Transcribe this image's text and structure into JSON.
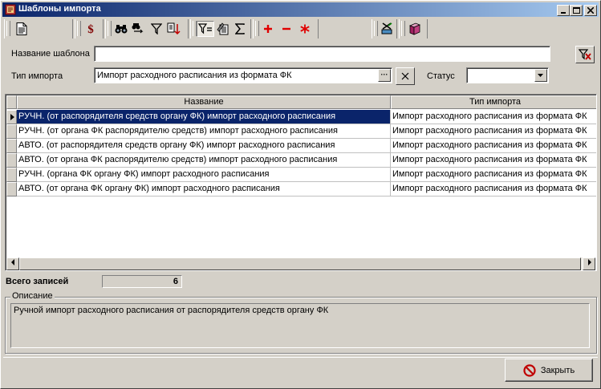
{
  "window": {
    "title": "Шаблоны импорта",
    "controls": [
      "minimize",
      "maximize",
      "close"
    ]
  },
  "toolbar": {
    "icons": [
      "new-document-icon",
      "money-icon",
      "binoculars-icon",
      "find-next-icon",
      "filter-icon",
      "sort-icon",
      "filter-by-selection-icon",
      "edit-list-icon",
      "sum-icon",
      "add-icon",
      "remove-icon",
      "asterisk-icon",
      "export-icon",
      "book-icon"
    ]
  },
  "filters": {
    "template_name_label": "Название шаблона",
    "template_name_value": "",
    "import_type_label": "Тип импорта",
    "import_type_value": "Импорт расходного расписания из формата ФК",
    "ellipsis_label": "···",
    "status_label": "Статус",
    "status_value": ""
  },
  "table": {
    "columns": [
      "Название",
      "Тип импорта"
    ],
    "rows": [
      {
        "name": "РУЧН. (от распорядителя средств органу ФК) импорт расходного расписания",
        "type": "Импорт расходного расписания из формата ФК",
        "selected": true
      },
      {
        "name": "РУЧН. (от органа ФК распорядителю средств) импорт расходного расписания",
        "type": "Импорт расходного расписания из формата ФК",
        "selected": false
      },
      {
        "name": "АВТО. (от распорядителя средств органу ФК) импорт расходного расписания",
        "type": "Импорт расходного расписания из формата ФК",
        "selected": false
      },
      {
        "name": "АВТО. (от органа ФК распорядителю средств) импорт расходного расписания",
        "type": "Импорт расходного расписания из формата ФК",
        "selected": false
      },
      {
        "name": "РУЧН. (органа ФК органу ФК) импорт расходного расписания",
        "type": "Импорт расходного расписания из формата ФК",
        "selected": false
      },
      {
        "name": "АВТО. (от органа ФК органу ФК) импорт расходного расписания",
        "type": "Импорт расходного расписания из формата ФК",
        "selected": false
      }
    ]
  },
  "totals": {
    "label": "Всего записей",
    "count": "6"
  },
  "description": {
    "legend": "Описание",
    "text": "Ручной импорт расходного расписания от распорядителя средств органу ФК"
  },
  "footer": {
    "close_label": "Закрыть"
  },
  "colors": {
    "selection": "#0a246a",
    "title_gradient_start": "#0a246a",
    "title_gradient_end": "#a6caf0",
    "face": "#d4d0c8"
  }
}
